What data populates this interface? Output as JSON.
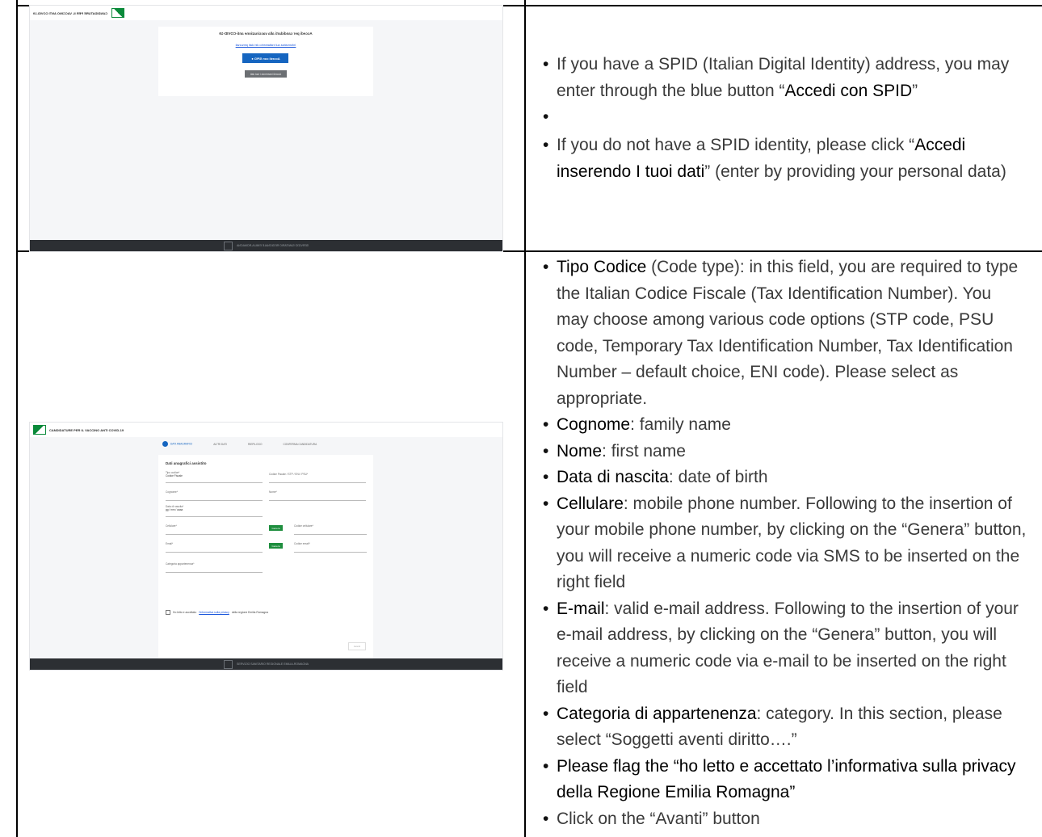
{
  "shot1": {
    "header_title": "CANDIDATURE PER IL VACCINO ANTI COVID-19",
    "card_title": "Accedi per candidarti alla vaccinazione anti-COVID-19",
    "card_link": "Informativa sul trattamento dei dati personali",
    "spid_button": "Accedi con SPID",
    "data_button": "Accedi inserendo i tuoi dati",
    "footer": "SERVIZIO SANITARIO REGIONALE EMILIA-ROMAGNA"
  },
  "shot2": {
    "header_title": "CANDIDATURE PER IL VACCINO ANTI COVID-19",
    "steps": [
      "DATI ANAGRAFICI",
      "ALTRI DATI",
      "RIEPILOGO",
      "CONFERMA CANDIDATURA"
    ],
    "section_title": "Dati anagrafici assistito",
    "fields": {
      "tipo_codice_label": "Tipo codice*",
      "tipo_codice_value": "Codice Fiscale",
      "codice_label": "Codice Fiscale / STP / ENI / PSU*",
      "cognome": "Cognome*",
      "nome": "Nome*",
      "data_label": "Data di nascita*",
      "data_value": "gg / mm / aaaa",
      "cellulare": "Cellulare*",
      "codice_cellulare": "Codice cellulare*",
      "email": "Email*",
      "codice_email": "Codice email*",
      "categoria": "Categoria appartenenza*"
    },
    "genera": "Genera",
    "privacy_pre": "Ho letto e accettato",
    "privacy_link": "l'informativa sulla privacy",
    "privacy_post": "della regione Emilia Romagna",
    "avanti": "Avanti",
    "footer": "SERVIZIO SANITARIO REGIONALE EMILIA-ROMAGNA"
  },
  "text1": {
    "b1_pre": "If you have a SPID (Italian Digital Identity) address, you may enter through the blue button “",
    "b1_bold": "Accedi con SPID",
    "b1_post": "”",
    "b2_pre": "If you do not have a SPID identity, please click “",
    "b2_bold": "Accedi inserendo I tuoi dati",
    "b2_post": "” (enter by providing your personal data)"
  },
  "text2": [
    {
      "bold": "Tipo Codice",
      "rest": " (Code type): in this field, you are required to type the Italian Codice Fiscale (Tax Identification Number). You may choose among various code options (STP code, PSU code, Temporary Tax Identification Number, Tax Identification Number – default choice, ENI code). Please select as appropriate."
    },
    {
      "bold": "Cognome",
      "rest": ": family name"
    },
    {
      "bold": "Nome",
      "rest": ": first name"
    },
    {
      "bold": "Data di nascita",
      "rest": ": date of birth"
    },
    {
      "bold": "Cellulare",
      "rest": ": mobile phone number. Following to the insertion of your mobile phone number, by clicking on the “Genera” button, you will receive a numeric code via SMS to be inserted on the right field"
    },
    {
      "bold": "E-mail",
      "rest": ": valid e-mail address. Following to the insertion of your e-mail address, by clicking on the “Genera” button, you will receive a numeric code via e-mail to be inserted on the right field"
    },
    {
      "bold": "Categoria di appartenenza",
      "rest": ": category. In this section, please select “Soggetti aventi diritto….”"
    },
    {
      "bold": "Please flag the “ho letto e accettato l’informativa sulla privacy della Regione Emilia Romagna”",
      "rest": ""
    },
    {
      "bold": "",
      "rest": "Click on the “Avanti” button"
    }
  ]
}
